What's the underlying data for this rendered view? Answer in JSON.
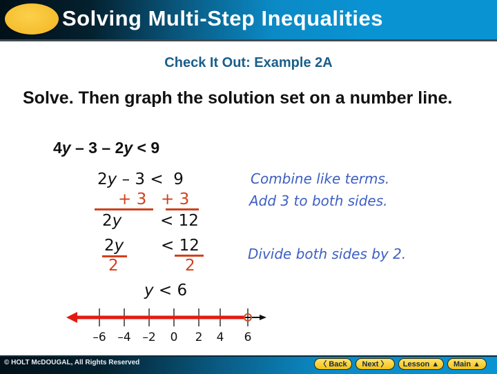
{
  "header": {
    "title": "Solving Multi-Step Inequalities"
  },
  "subtitle": "Check It Out: Example 2A",
  "prompt": "Solve. Then graph the solution set on a number line.",
  "problem": "4y – 3 – 2y < 9",
  "steps": {
    "line1": "2y – 3 <  9",
    "line2_left": "+ 3",
    "line2_right": "+ 3",
    "line3_left": "2y",
    "line3_right": "< 12",
    "line4_left_num": "2y",
    "line4_right": "< 12",
    "line4_left_den": "2",
    "line4_right_den": "2",
    "result": "y < 6"
  },
  "notes": {
    "combine": "Combine like terms.",
    "add": "Add 3 to both sides.",
    "divide": "Divide both sides by 2."
  },
  "number_line": {
    "ticks": [
      -6,
      -4,
      -2,
      0,
      2,
      4,
      6
    ],
    "tick_labels": [
      "–6",
      "–4",
      "–2",
      "0",
      "2",
      "4",
      "6"
    ],
    "solution": "y < 6",
    "endpoint": 6,
    "endpoint_type": "open",
    "shaded_direction": "left",
    "shade_color": "#e31b12",
    "circle_color": "#c8502a"
  },
  "footer": {
    "copyright": "© HOLT McDOUGAL, All Rights Reserved",
    "buttons": {
      "back": "〈 Back",
      "next": "Next 〉",
      "lesson": "Lesson",
      "main": "Main"
    }
  },
  "colors": {
    "title_blue": "#1a5e8a",
    "note_blue": "#3d5fc2",
    "step_red": "#d2401c",
    "sun_yellow": "#f5bd2e"
  }
}
